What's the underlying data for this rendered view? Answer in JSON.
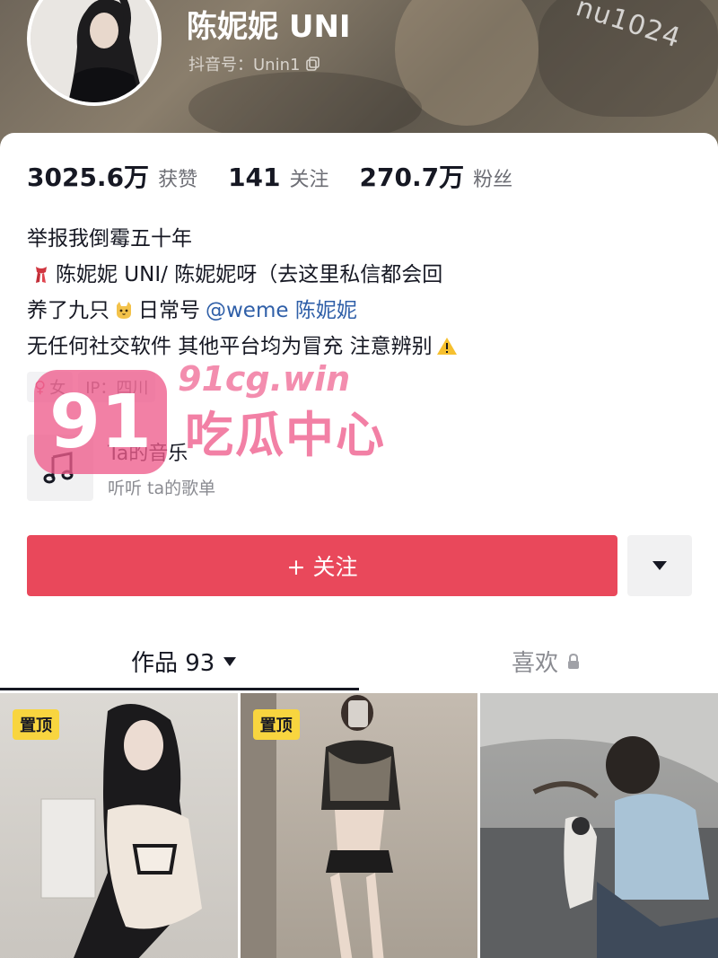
{
  "header": {
    "watermark_top": "nu1024",
    "name": "陈妮妮 UNI",
    "douyin_id": "抖音号：Unin1"
  },
  "stats": [
    {
      "num": "3025.6万",
      "label": "获赞"
    },
    {
      "num": "141",
      "label": "关注"
    },
    {
      "num": "270.7万",
      "label": "粉丝"
    }
  ],
  "bio": {
    "line1": "举报我倒霉五十年",
    "line2": "陈妮妮 UNI/ 陈妮妮呀（去这里私信都会回",
    "line3_prefix": "养了九只",
    "line3_mid": "日常号",
    "line3_link": "@weme 陈妮妮",
    "line4": "无任何社交软件 其他平台均为冒充 注意辨别"
  },
  "tags": {
    "gender": "女",
    "ip": "IP：四川"
  },
  "music": {
    "title": "Ta的音乐",
    "subtitle": "听听 ta的歌单"
  },
  "actions": {
    "follow_label": "+ 关注"
  },
  "tabs": {
    "works_label": "作品 93",
    "likes_label": "喜欢"
  },
  "grid": {
    "pin_label": "置顶"
  },
  "watermark": {
    "badge": "91",
    "domain": "91cg.win",
    "text": "吃瓜中心"
  },
  "colors": {
    "follow": "#e9485b",
    "link": "#2f5fa8",
    "pin": "#f8d53f",
    "watermark": "#ee5c8c"
  }
}
